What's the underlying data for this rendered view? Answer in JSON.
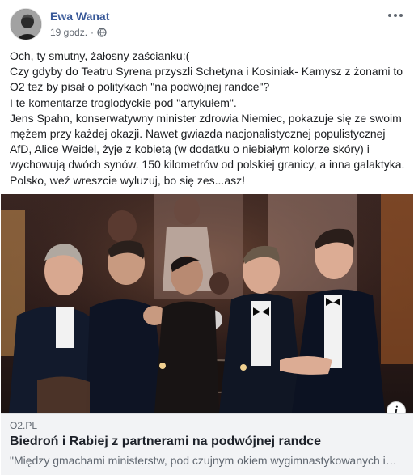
{
  "post": {
    "author": "Ewa Wanat",
    "time": "19 godz.",
    "time_separator": "·",
    "privacy_icon": "globe-icon",
    "more_icon": "more-options-icon",
    "text_lines": [
      "Och, ty smutny, żałosny zaścianku:(",
      "Czy gdyby do Teatru Syrena przyszli Schetyna i Kosiniak- Kamysz z żonami to O2 też by pisał o politykach \"na podwójnej randce\"?",
      "I te komentarze troglodyckie pod \"artykułem\".",
      "Jens Spahn, konserwatywny minister zdrowia Niemiec, pokazuje się ze swoim mężem przy każdej okazji. Nawet gwiazda nacjonalistycznej populistycznej AfD, Alice Weidel, żyje z kobietą (w dodatku o niebiałym kolorze skóry) i wychowują dwóch synów. 150 kilometrów od polskiej granicy, a inna galaktyka. Polsko, weź wreszcie wyluzuj, bo się zes...asz!"
    ]
  },
  "link_card": {
    "domain": "O2.PL",
    "title": "Biedroń i Rabiej z partnerami na podwójnej randce",
    "description": "\"Między gmachami ministerstw, pod czujnym okiem wygimnastykowanych i…",
    "info_icon": "i"
  },
  "colors": {
    "author": "#385898",
    "text": "#1c1e21",
    "meta": "#616770",
    "card_bg": "#f2f3f5"
  }
}
